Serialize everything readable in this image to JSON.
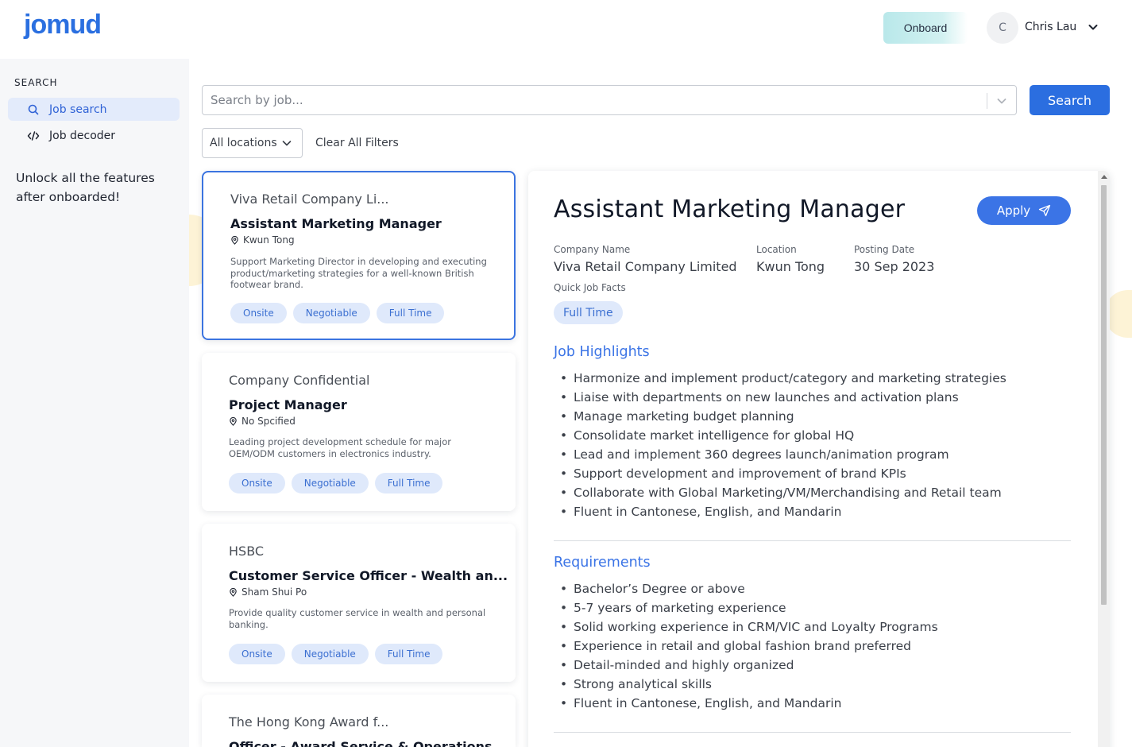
{
  "header": {
    "logo": "jomud",
    "onboard_label": "Onboard",
    "user": {
      "initial": "C",
      "name": "Chris Lau"
    }
  },
  "sidebar": {
    "heading": "SEARCH",
    "items": [
      {
        "label": "Job search",
        "icon": "search-icon",
        "active": true
      },
      {
        "label": "Job decoder",
        "icon": "code-icon",
        "active": false
      }
    ],
    "promo": "Unlock all the features after onboarded!"
  },
  "search": {
    "placeholder": "Search by job...",
    "button_label": "Search"
  },
  "filters": {
    "location": "All locations",
    "clear_label": "Clear All Filters"
  },
  "jobs": [
    {
      "company": "Viva Retail Company Li...",
      "title": "Assistant Marketing Manager",
      "location": "Kwun Tong",
      "description": "Support Marketing Director in developing and executing product/marketing strategies for a well-known British footwear brand.",
      "tags": [
        "Onsite",
        "Negotiable",
        "Full Time"
      ]
    },
    {
      "company": "Company Confidential",
      "title": "Project Manager",
      "location": "No Spcified",
      "description": "Leading project development schedule for major OEM/ODM customers in electronics industry.",
      "tags": [
        "Onsite",
        "Negotiable",
        "Full Time"
      ]
    },
    {
      "company": "HSBC",
      "title": "Customer Service Officer - Wealth an...",
      "location": "Sham Shui Po",
      "description": "Provide quality customer service in wealth and personal banking.",
      "tags": [
        "Onsite",
        "Negotiable",
        "Full Time"
      ]
    },
    {
      "company": "The Hong Kong Award f...",
      "title": "Officer - Award Service & Operations"
    }
  ],
  "detail": {
    "title": "Assistant Marketing Manager",
    "apply_label": "Apply",
    "company_label": "Company Name",
    "company": "Viva Retail Company Limited",
    "location_label": "Location",
    "location": "Kwun Tong",
    "date_label": "Posting Date",
    "date": "30 Sep 2023",
    "facts_label": "Quick Job Facts",
    "facts": [
      "Full Time"
    ],
    "highlights_title": "Job Highlights",
    "highlights": [
      "Harmonize and implement product/category and marketing strategies",
      "Liaise with departments on new launches and activation plans",
      "Manage marketing budget planning",
      "Consolidate market intelligence for global HQ",
      "Lead and implement 360 degrees launch/animation program",
      "Support development and improvement of brand KPIs",
      "Collaborate with Global Marketing/VM/Merchandising and Retail team",
      "Fluent in Cantonese, English, and Mandarin"
    ],
    "requirements_title": "Requirements",
    "requirements": [
      "Bachelor’s Degree or above",
      "5-7 years of marketing experience",
      "Solid working experience in CRM/VIC and Loyalty Programs",
      "Experience in retail and global fashion brand preferred",
      "Detail-minded and highly organized",
      "Strong analytical skills",
      "Fluent in Cantonese, English, and Mandarin"
    ]
  },
  "colors": {
    "primary": "#2b6ee0",
    "tag_bg": "#dfe9fb",
    "tag_text": "#3b6fd1",
    "sidebar_bg": "#f6f7f9"
  }
}
